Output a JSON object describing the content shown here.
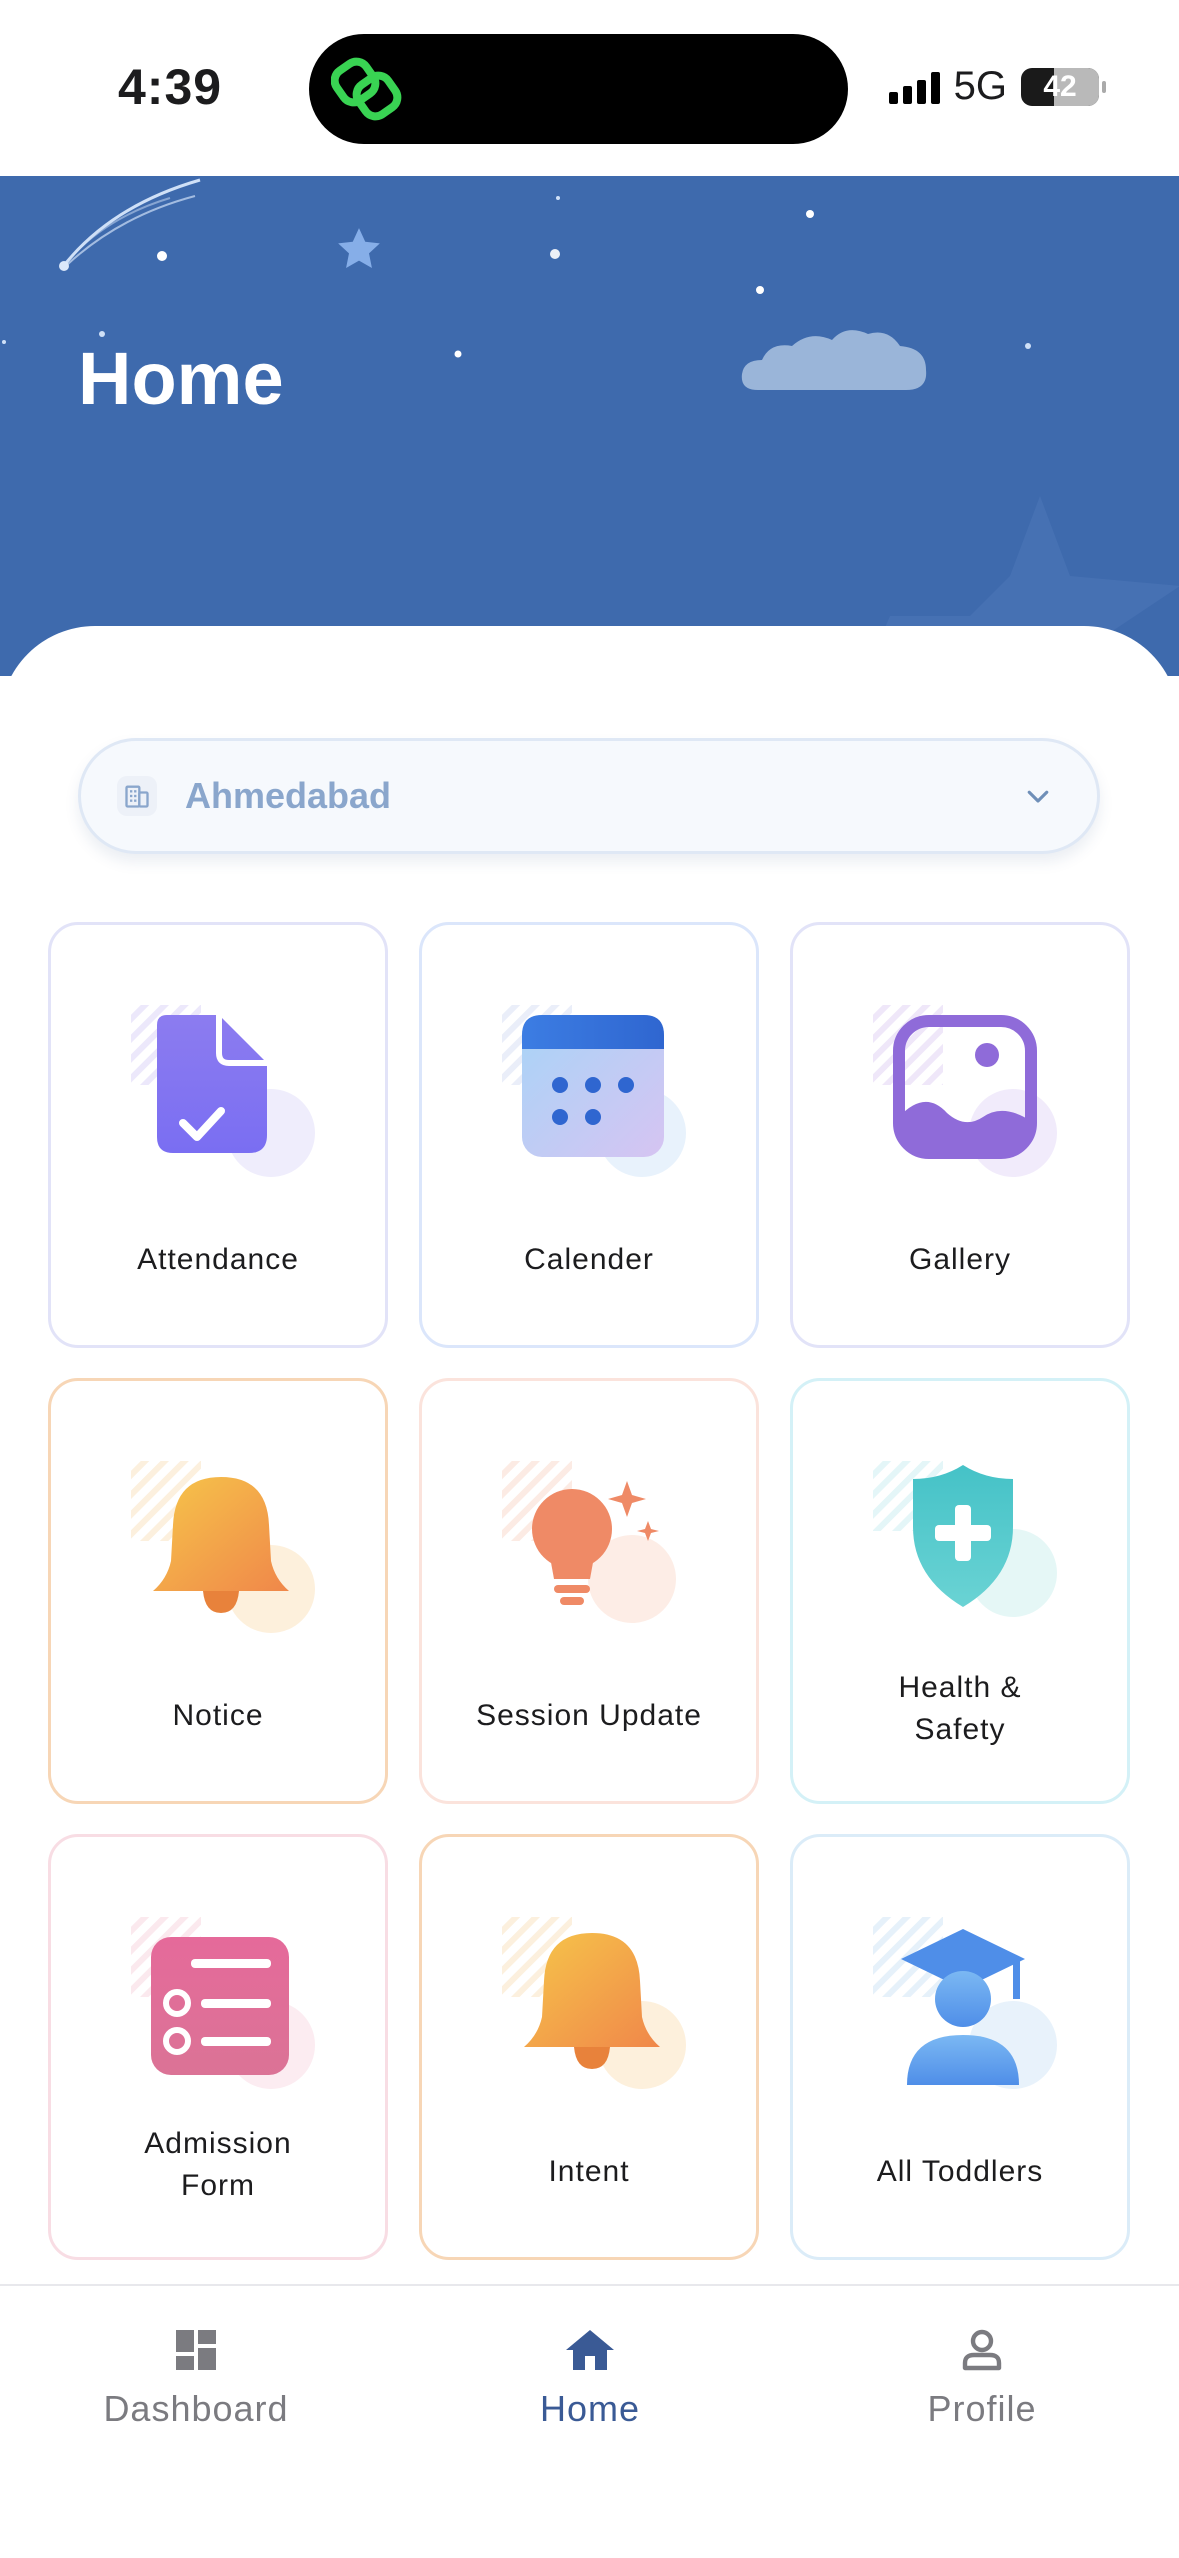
{
  "status_bar": {
    "time": "4:39",
    "network": "5G",
    "battery": "42"
  },
  "header": {
    "title": "Home"
  },
  "branch_select": {
    "value": "Ahmedabad"
  },
  "tiles": [
    {
      "label": "Attendance"
    },
    {
      "label": "Calender"
    },
    {
      "label": "Gallery"
    },
    {
      "label": "Notice"
    },
    {
      "label": "Session Update"
    },
    {
      "label": "Health & Safety"
    },
    {
      "label": "Admission Form"
    },
    {
      "label": "Intent"
    },
    {
      "label": "All Toddlers"
    }
  ],
  "bottom_nav": {
    "items": [
      {
        "label": "Dashboard",
        "icon": "dashboard-icon"
      },
      {
        "label": "Home",
        "icon": "home-icon"
      },
      {
        "label": "Profile",
        "icon": "profile-icon"
      }
    ],
    "active": "Home"
  },
  "colors": {
    "header_bg": "#3e6aad",
    "nav_active": "#3a5a95",
    "nav_inactive": "#7b7b80"
  }
}
